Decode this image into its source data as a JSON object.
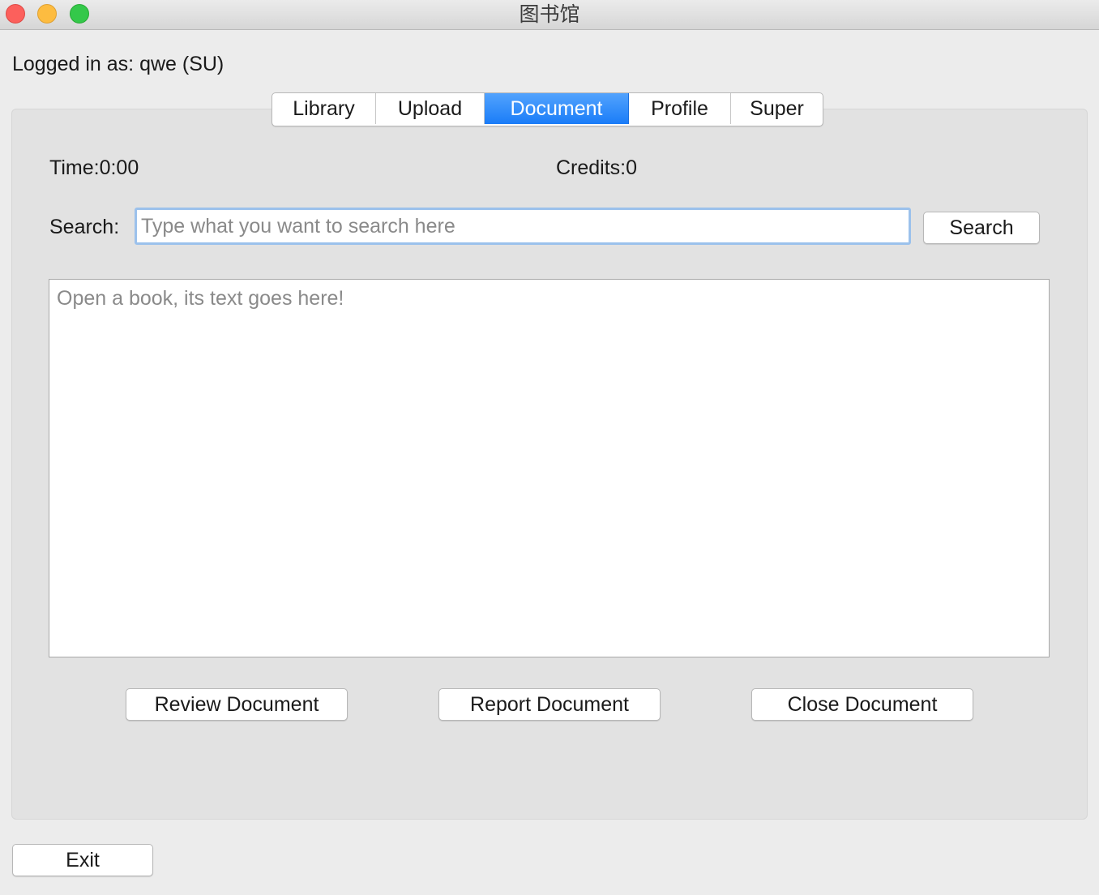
{
  "window": {
    "title": "图书馆"
  },
  "session": {
    "logged_in_text": "Logged in as: qwe (SU)"
  },
  "tabs": [
    {
      "label": "Library",
      "active": false
    },
    {
      "label": "Upload",
      "active": false
    },
    {
      "label": "Document",
      "active": true
    },
    {
      "label": "Profile",
      "active": false
    },
    {
      "label": "Super",
      "active": false
    }
  ],
  "document_tab": {
    "time_text": "Time:0:00",
    "credits_text": "Credits:0",
    "search_label": "Search:",
    "search_placeholder": "Type what you want to search here",
    "search_button": "Search",
    "text_area_placeholder": "Open a book, its text goes here!",
    "review_button": "Review Document",
    "report_button": "Report Document",
    "close_button": "Close Document"
  },
  "footer": {
    "exit_button": "Exit"
  },
  "colors": {
    "accent_active_tab": "#1a7cf8",
    "window_background": "#ececec",
    "panel_background": "#e2e2e2",
    "focus_ring": "#9bc1ec"
  }
}
